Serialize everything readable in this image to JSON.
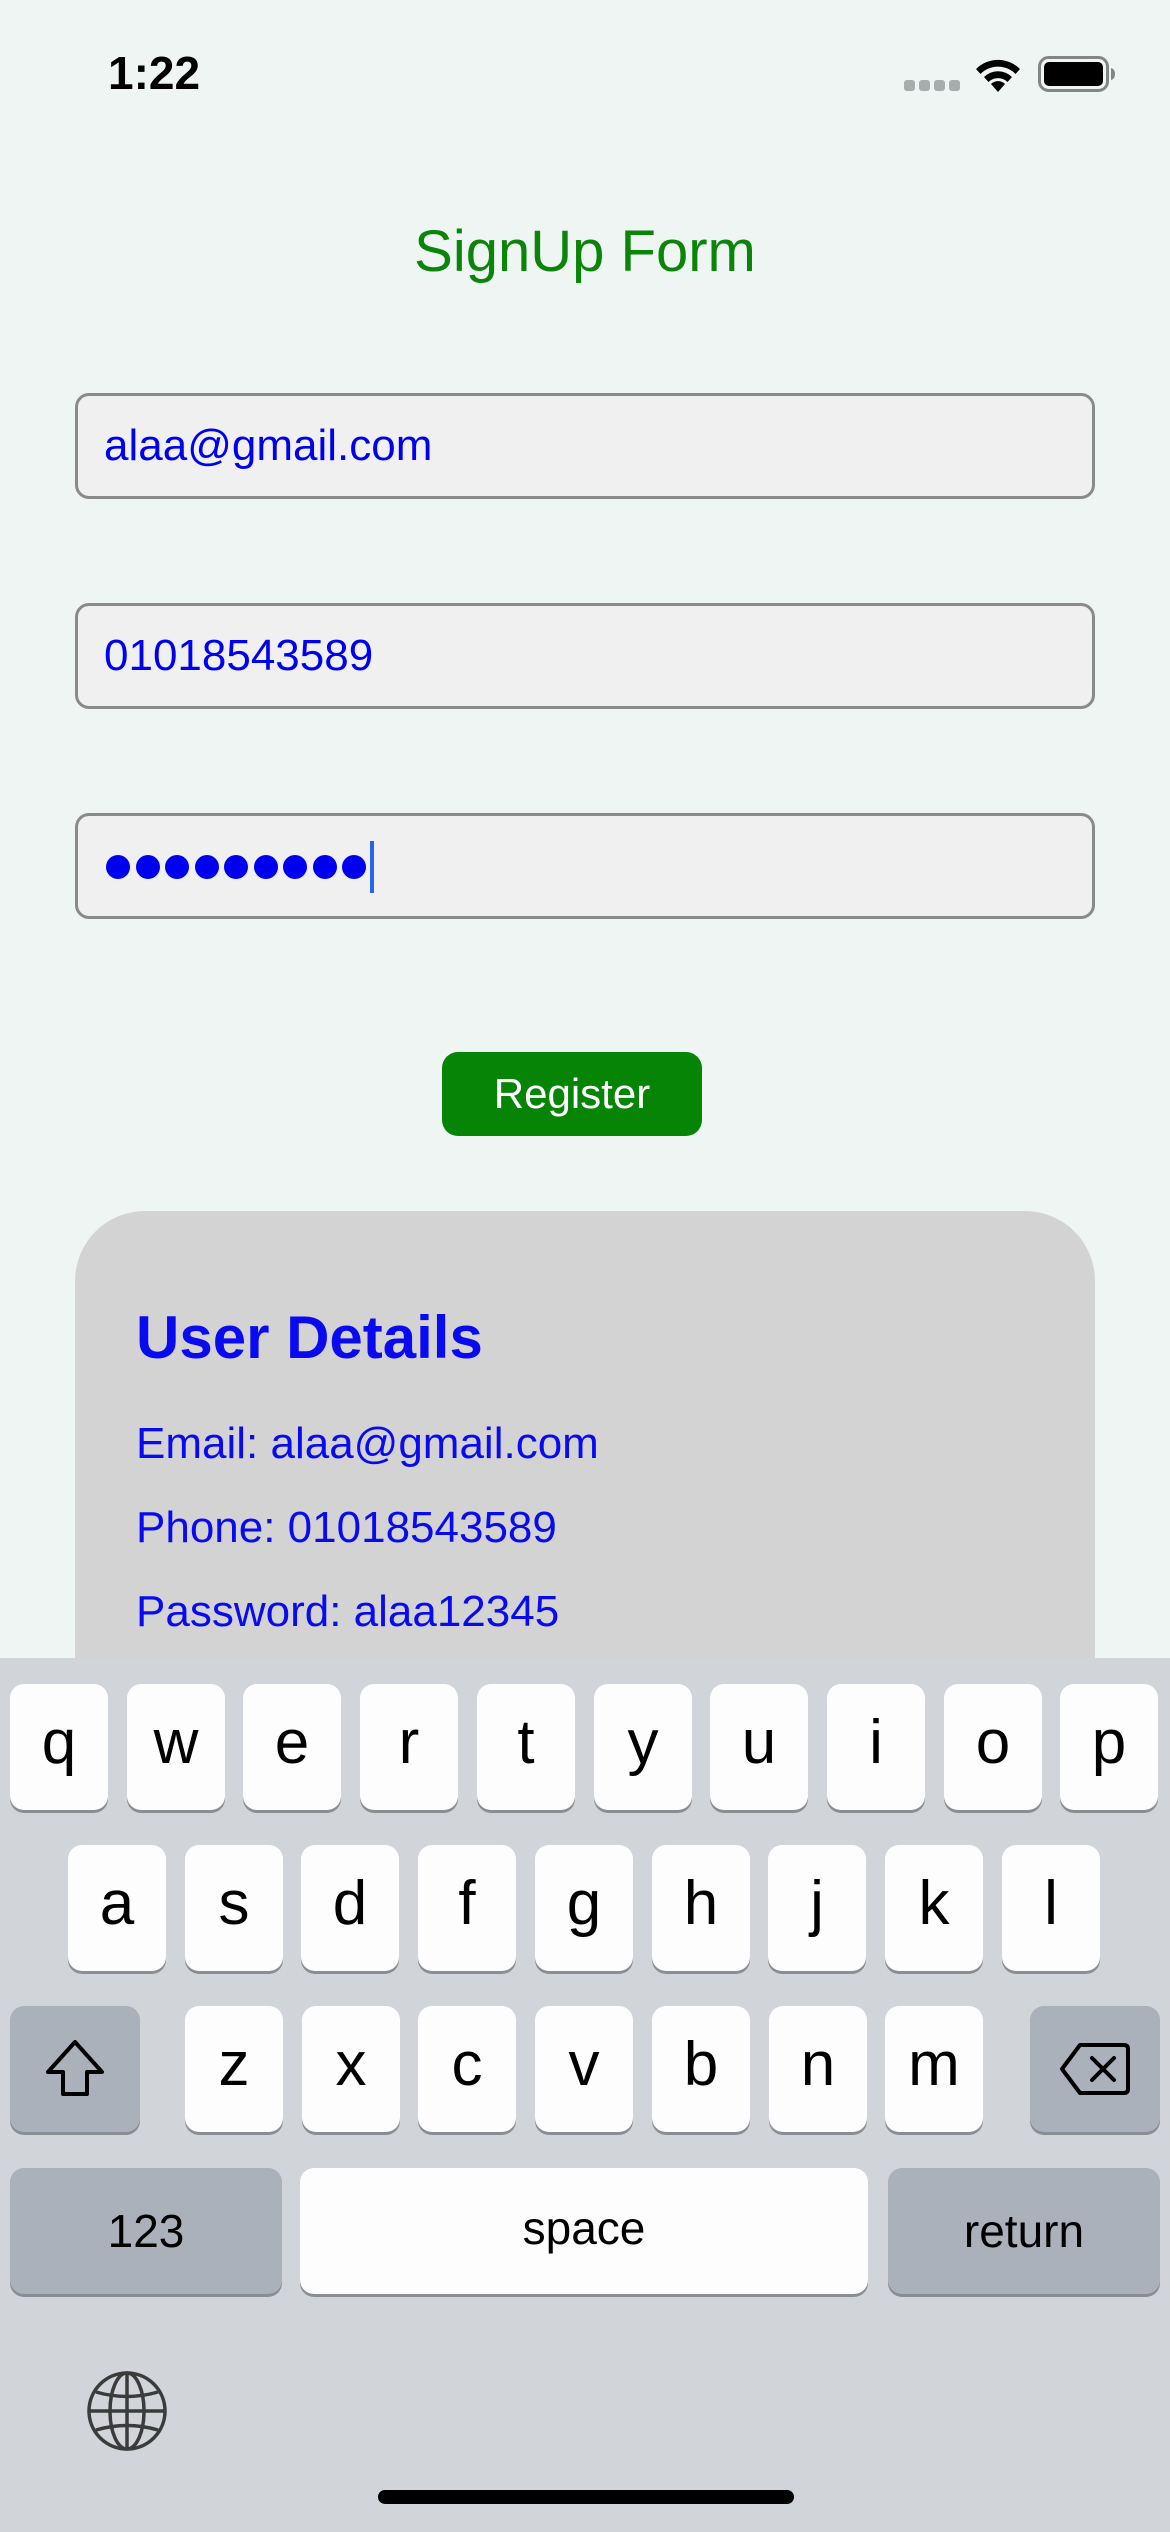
{
  "status": {
    "time": "1:22"
  },
  "form": {
    "title": "SignUp Form",
    "email_value": "alaa@gmail.com",
    "phone_value": "01018543589",
    "password_mask_count": 9,
    "register_label": "Register"
  },
  "details": {
    "title": "User Details",
    "email_line": "Email: alaa@gmail.com",
    "phone_line": "Phone: 01018543589",
    "password_line": "Password: alaa12345"
  },
  "keyboard": {
    "row1": [
      "q",
      "w",
      "e",
      "r",
      "t",
      "y",
      "u",
      "i",
      "o",
      "p"
    ],
    "row2": [
      "a",
      "s",
      "d",
      "f",
      "g",
      "h",
      "j",
      "k",
      "l"
    ],
    "row3": [
      "z",
      "x",
      "c",
      "v",
      "b",
      "n",
      "m"
    ],
    "numbers_label": "123",
    "space_label": "space",
    "return_label": "return",
    "shift_icon": "shift-icon",
    "delete_icon": "delete-icon",
    "globe_icon": "globe-icon"
  },
  "colors": {
    "title_green": "#0a850a",
    "input_text_blue": "#0000f0",
    "button_green": "#068406",
    "card_gray": "#d3d3d3"
  }
}
